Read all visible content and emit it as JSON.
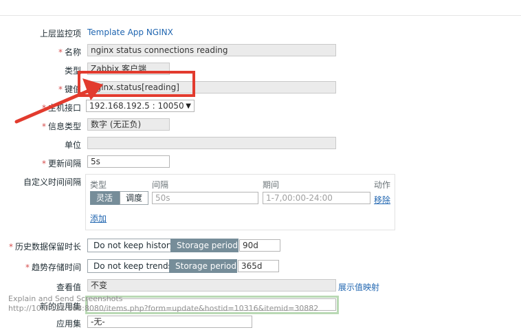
{
  "form": {
    "parent_template": {
      "label": "上层监控项",
      "value": "Template App NGINX"
    },
    "name": {
      "label": "名称",
      "value": "nginx status connections reading"
    },
    "type": {
      "label": "类型",
      "value": "Zabbix 客户端"
    },
    "key": {
      "label": "键值",
      "value": "nginx.status[reading]"
    },
    "host_interface": {
      "label": "主机接口",
      "value": "192.168.192.5 : 10050"
    },
    "info_type": {
      "label": "信息类型",
      "value": "数字 (无正负)"
    },
    "units": {
      "label": "单位",
      "value": ""
    },
    "update_interval": {
      "label": "更新间隔",
      "value": "5s"
    },
    "custom_intervals": {
      "label": "自定义时间间隔",
      "headers": {
        "type": "类型",
        "interval": "间隔",
        "period": "期间",
        "action": "动作"
      },
      "row": {
        "flexible": "灵活",
        "scheduling": "调度",
        "interval_placeholder": "50s",
        "period_placeholder": "1-7,00:00-24:00",
        "remove": "移除"
      },
      "add": "添加"
    },
    "history": {
      "label": "历史数据保留时长",
      "no_keep": "Do not keep history",
      "storage": "Storage period",
      "value": "90d"
    },
    "trends": {
      "label": "趋势存储时间",
      "no_keep": "Do not keep trends",
      "storage": "Storage period",
      "value": "365d"
    },
    "show_value": {
      "label": "查看值",
      "value": "不变",
      "link": "展示值映射"
    },
    "new_application": {
      "label": "新的应用集",
      "value": ""
    },
    "application": {
      "label": "应用集",
      "value": "-无-"
    }
  },
  "overlay": {
    "line1": "Explain and Send Screenshots",
    "line2": "http://10.0.122.168:8080/items.php?form=update&hostid=10316&itemid=30882"
  },
  "colors": {
    "annotation": "#e23b2e",
    "accent": "#768d99",
    "link": "#1f65b0"
  }
}
